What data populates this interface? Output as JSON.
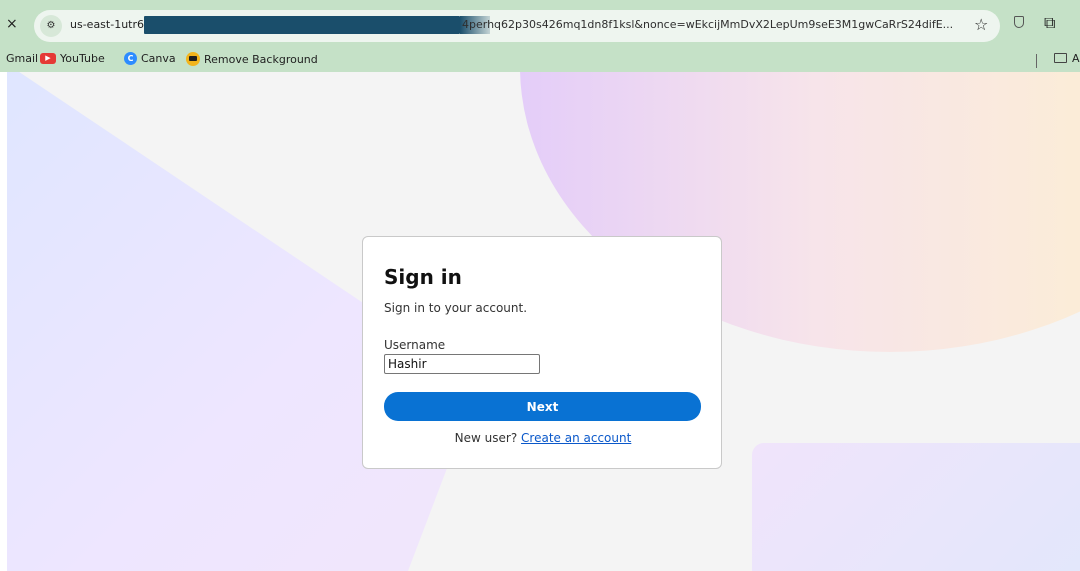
{
  "browser": {
    "close_symbol": "×",
    "url_prefix": "us-east-1utr6",
    "url_suffix": "4perhq62p30s426mq1dn8f1ksl&nonce=wEkcijMmDvX2LepUm9seE3M1gwCaRrS24difE...",
    "icons": [
      "tune-icon",
      "star-icon",
      "shield-icon",
      "extensions-icon",
      "folder-icon"
    ]
  },
  "bookmarks": {
    "items": [
      {
        "label": "Gmail",
        "icon": "none"
      },
      {
        "label": "YouTube",
        "icon": "youtube-icon"
      },
      {
        "label": "Canva",
        "icon": "canva-icon"
      },
      {
        "label": "Remove Background",
        "icon": "remove-bg-icon"
      }
    ],
    "overflow_cut": "A"
  },
  "signin": {
    "title": "Sign in",
    "subtitle": "Sign in to your account.",
    "username_label": "Username",
    "username_value": "Hashir",
    "next_label": "Next",
    "new_user_text": "New user?",
    "create_account_label": "Create an account"
  },
  "colors": {
    "chrome_green": "#c5e1c7",
    "primary_button": "#0972d3",
    "link": "#0a58ca"
  }
}
